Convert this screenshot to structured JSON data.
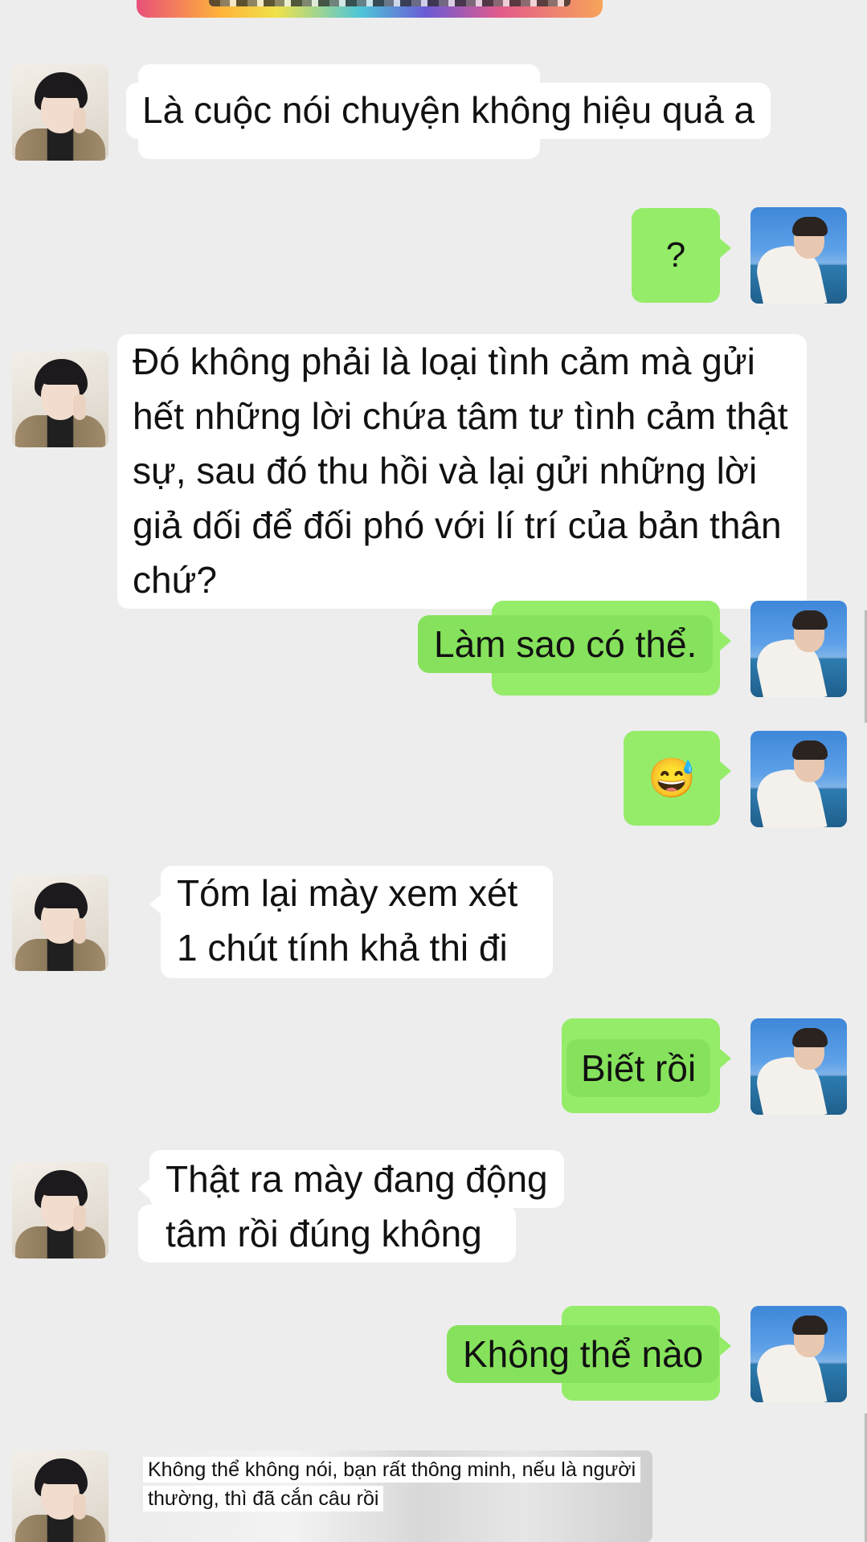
{
  "messages": [
    {
      "id": "m1",
      "from": "other",
      "text": "Là cuộc nói chuyện không hiệu quả a"
    },
    {
      "id": "m2",
      "from": "me",
      "text": "?"
    },
    {
      "id": "m3",
      "from": "other",
      "lines": [
        "Đó không phải là loại tình cảm mà gửi",
        "hết những lời chứa tâm tư tình cảm thật",
        "sự, sau đó thu hồi và lại gửi những lời",
        "giả dối để đối phó với lí trí của bản thân",
        "chứ?"
      ]
    },
    {
      "id": "m4",
      "from": "me",
      "text": "Làm sao có thể."
    },
    {
      "id": "m5",
      "from": "me",
      "text": "😅"
    },
    {
      "id": "m6",
      "from": "other",
      "lines": [
        "Tóm lại mày xem xét",
        "1 chút tính khả thi đi"
      ]
    },
    {
      "id": "m7",
      "from": "me",
      "text": "Biết rồi"
    },
    {
      "id": "m8",
      "from": "other",
      "lines": [
        "Thật ra mày đang động",
        "tâm rồi đúng không"
      ]
    },
    {
      "id": "m9",
      "from": "me",
      "text": "Không thể nào"
    },
    {
      "id": "m10",
      "from": "other",
      "type": "image",
      "caption_lines": [
        "Không thể không nói, bạn rất thông minh, nếu là người",
        "thường, thì đã cắn câu rồi"
      ]
    }
  ],
  "colors": {
    "background": "#ededed",
    "incoming_bubble": "#ffffff",
    "outgoing_bubble": "#95ec69"
  }
}
